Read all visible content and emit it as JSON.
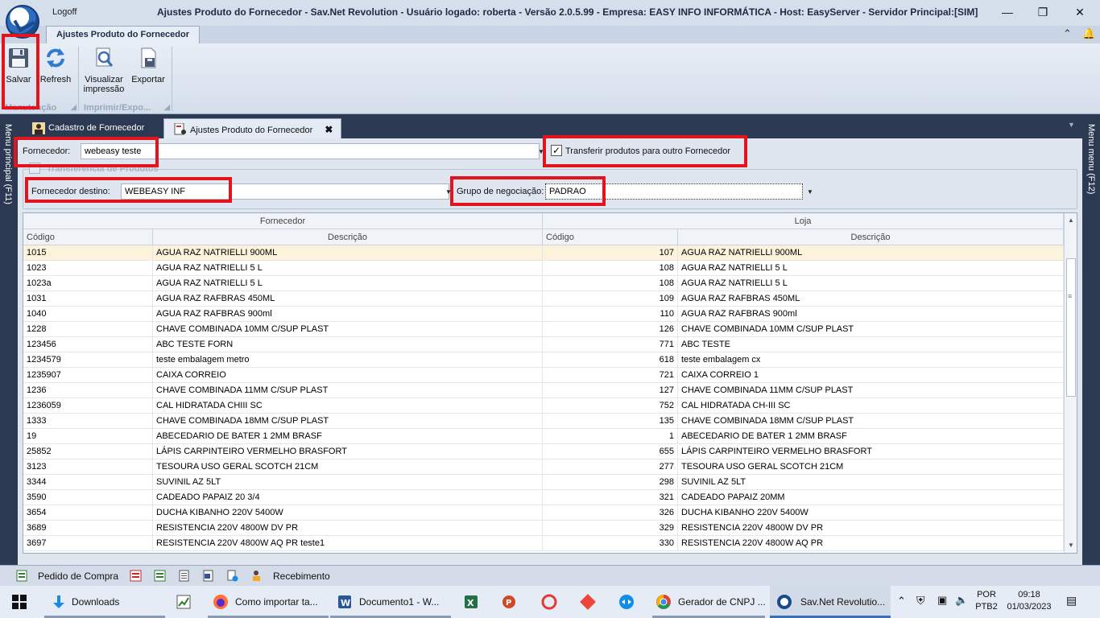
{
  "window": {
    "logoff_label": "Logoff",
    "title": "Ajustes Produto do Fornecedor - Sav.Net Revolution - Usuário logado: roberta - Versão 2.0.5.99 - Empresa: EASY INFO INFORMÁTICA - Host: EasyServer - Servidor Principal:[SIM]"
  },
  "ribbon": {
    "tab_label": "Ajustes Produto do Fornecedor",
    "buttons": {
      "save": "Salvar",
      "refresh": "Refresh",
      "preview_line1": "Visualizar",
      "preview_line2": "impressão",
      "export": "Exportar"
    },
    "groups": {
      "maintenance": "Manutenção",
      "print_export": "Imprimir/Expo..."
    }
  },
  "rails": {
    "left": "Menu principal (F11)",
    "right": "Menu menu (F12)"
  },
  "doc_tabs": [
    {
      "label": "Cadastro de Fornecedor"
    },
    {
      "label": "Ajustes Produto do Fornecedor"
    }
  ],
  "form": {
    "supplier_label": "Fornecedor:",
    "supplier_value": "webeasy teste",
    "transfer_checkbox_label": "Transferir produtos para outro Fornecedor",
    "transfer_checked": true,
    "transfer_group_label": "Transferência de Produtos",
    "dest_supplier_label": "Fornecedor destino:",
    "dest_supplier_value": "WEBEASY INF",
    "negotiation_group_label": "Grupo de negociação:",
    "negotiation_group_value": "PADRAO"
  },
  "grid": {
    "bands": [
      "Fornecedor",
      "Loja"
    ],
    "columns": [
      "Código",
      "Descrição",
      "Código",
      "Descrição"
    ],
    "rows": [
      [
        "1015",
        "AGUA RAZ NATRIELLI 900ML",
        "107",
        "AGUA RAZ NATRIELLI 900ML"
      ],
      [
        "1023",
        "AGUA RAZ NATRIELLI 5 L",
        "108",
        "AGUA RAZ NATRIELLI 5 L"
      ],
      [
        "1023a",
        "AGUA RAZ NATRIELLI 5 L",
        "108",
        "AGUA RAZ NATRIELLI 5 L"
      ],
      [
        "1031",
        "AGUA RAZ RAFBRAS 450ML",
        "109",
        "AGUA RAZ RAFBRAS 450ML"
      ],
      [
        "1040",
        "AGUA RAZ RAFBRAS 900ml",
        "110",
        "AGUA RAZ RAFBRAS 900ml"
      ],
      [
        "1228",
        "CHAVE COMBINADA 10MM C/SUP PLAST",
        "126",
        "CHAVE COMBINADA 10MM C/SUP PLAST"
      ],
      [
        "123456",
        "ABC TESTE FORN",
        "771",
        "ABC TESTE"
      ],
      [
        "1234579",
        "teste embalagem metro",
        "618",
        "teste embalagem cx"
      ],
      [
        "1235907",
        "CAIXA CORREIO",
        "721",
        "CAIXA CORREIO 1"
      ],
      [
        "1236",
        "CHAVE COMBINADA 11MM C/SUP PLAST",
        "127",
        "CHAVE COMBINADA 11MM C/SUP PLAST"
      ],
      [
        "1236059",
        "CAL HIDRATADA CHIII SC",
        "752",
        "CAL HIDRATADA CH-III SC"
      ],
      [
        "1333",
        "CHAVE COMBINADA 18MM C/SUP PLAST",
        "135",
        "CHAVE COMBINADA 18MM C/SUP PLAST"
      ],
      [
        "19",
        "ABECEDARIO DE BATER 1 2MM BRASF",
        "1",
        "ABECEDARIO DE BATER 1 2MM BRASF"
      ],
      [
        "25852",
        "LÁPIS CARPINTEIRO VERMELHO BRASFORT",
        "655",
        "LÁPIS CARPINTEIRO VERMELHO BRASFORT"
      ],
      [
        "3123",
        "TESOURA USO GERAL SCOTCH 21CM",
        "277",
        "TESOURA USO GERAL SCOTCH 21CM"
      ],
      [
        "3344",
        "SUVINIL AZ 5LT",
        "298",
        "SUVINIL AZ 5LT"
      ],
      [
        "3590",
        "CADEADO PAPAIZ 20 3/4",
        "321",
        "CADEADO PAPAIZ 20MM"
      ],
      [
        "3654",
        "DUCHA KIBANHO 220V 5400W",
        "326",
        "DUCHA KIBANHO 220V 5400W"
      ],
      [
        "3689",
        "RESISTENCIA 220V 4800W DV PR",
        "329",
        "RESISTENCIA 220V 4800W DV PR"
      ],
      [
        "3697",
        "RESISTENCIA 220V 4800W AQ PR teste1",
        "330",
        "RESISTENCIA 220V 4800W AQ PR"
      ]
    ]
  },
  "bottombar": {
    "purchase_order": "Pedido de Compra",
    "receiving": "Recebimento"
  },
  "taskbar": {
    "items": [
      "Downloads",
      "Como importar ta...",
      "Documento1 - W...",
      "Gerador de CNPJ ...",
      "Sav.Net Revolutio..."
    ],
    "lang_line1": "POR",
    "lang_line2": "PTB2",
    "time": "09:18",
    "date": "01/03/2023"
  },
  "colors": {
    "highlight_red": "#e3141c",
    "selected_row": "#fdf3da",
    "dark_frame": "#2b3a52"
  }
}
